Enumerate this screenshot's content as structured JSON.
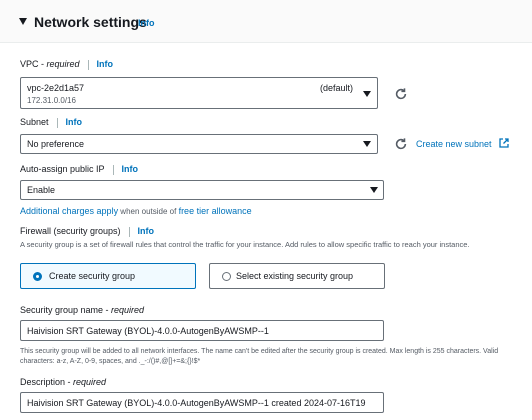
{
  "section": {
    "title": "Network settings",
    "info": "Info"
  },
  "vpc": {
    "label": "VPC - ",
    "required": "required",
    "info": "Info",
    "value": "vpc-2e2d1a57",
    "cidr": "172.31.0.0/16",
    "default_tag": "(default)"
  },
  "subnet": {
    "label": "Subnet",
    "info": "Info",
    "value": "No preference",
    "create_link": "Create new subnet"
  },
  "auto_ip": {
    "label": "Auto-assign public IP",
    "info": "Info",
    "value": "Enable",
    "charges_link": "Additional charges apply",
    "charges_mid": " when outside of ",
    "tier_link": "free tier allowance"
  },
  "firewall": {
    "label": "Firewall (security groups)",
    "info": "Info",
    "description": "A security group is a set of firewall rules that control the traffic for your instance. Add rules to allow specific traffic to reach your instance.",
    "option_create": "Create security group",
    "option_select": "Select existing security group"
  },
  "sg_name": {
    "label": "Security group name - ",
    "required": "required",
    "value": "Haivision SRT Gateway (BYOL)-4.0.0-AutogenByAWSMP--1",
    "help": "This security group will be added to all network interfaces. The name can't be edited after the security group is created. Max length is 255 characters. Valid characters: a-z, A-Z, 0-9, spaces, and ._-:/()#,@[]+=&;{}!$*"
  },
  "description": {
    "label": "Description - ",
    "required": "required",
    "value": "Haivision SRT Gateway (BYOL)-4.0.0-AutogenByAWSMP--1 created 2024-07-16T19"
  },
  "colors": {
    "link": "#0073bb",
    "selected_border": "#0073bb",
    "selected_bg": "#f1faff"
  },
  "icons": {
    "refresh": "refresh-icon",
    "external": "external-link-icon",
    "caret": "caret-down-icon"
  }
}
